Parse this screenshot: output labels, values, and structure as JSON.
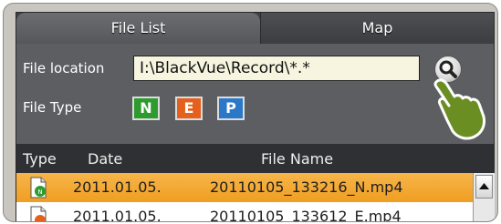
{
  "tabs": [
    {
      "label": "File List",
      "active": true
    },
    {
      "label": "Map",
      "active": false
    }
  ],
  "file_location": {
    "label": "File location",
    "value": "I:\\BlackVue\\Record\\*.*"
  },
  "file_type": {
    "label": "File Type",
    "buttons": [
      {
        "label": "N",
        "color": "#2e9b2e"
      },
      {
        "label": "E",
        "color": "#e4601c"
      },
      {
        "label": "P",
        "color": "#2b78c8"
      }
    ]
  },
  "table": {
    "headers": [
      "Type",
      "Date",
      "File Name"
    ],
    "rows": [
      {
        "type_icon": "file-normal-icon",
        "date": "2011.01.05.",
        "file_name": "20110105_133216_N.mp4",
        "selected": true
      },
      {
        "type_icon": "file-event-icon",
        "date": "2011.01.05.",
        "file_name": "20110105_133612_E.mp4",
        "selected": false
      }
    ]
  },
  "colors": {
    "selected_row": "#f2a32a",
    "hand_pointer": "#6b8e23"
  }
}
